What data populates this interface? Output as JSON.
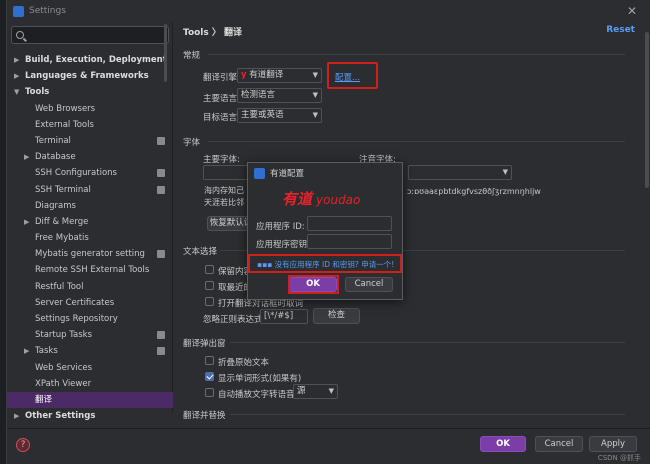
{
  "window": {
    "title": "Settings",
    "close": "✕"
  },
  "search": {
    "placeholder": ""
  },
  "tree": [
    {
      "label": "Build, Execution, Deployment",
      "level": 0,
      "bold": true,
      "chevron": "▶",
      "badge": false
    },
    {
      "label": "Languages & Frameworks",
      "level": 0,
      "bold": true,
      "chevron": "▶",
      "badge": false
    },
    {
      "label": "Tools",
      "level": 0,
      "bold": true,
      "chevron": "▼",
      "badge": false
    },
    {
      "label": "Web Browsers",
      "level": 1,
      "bold": false,
      "chevron": "",
      "badge": false
    },
    {
      "label": "External Tools",
      "level": 1,
      "bold": false,
      "chevron": "",
      "badge": false
    },
    {
      "label": "Terminal",
      "level": 1,
      "bold": false,
      "chevron": "",
      "badge": true
    },
    {
      "label": "Database",
      "level": 1,
      "bold": false,
      "chevron": "▶",
      "badge": false
    },
    {
      "label": "SSH Configurations",
      "level": 1,
      "bold": false,
      "chevron": "",
      "badge": true
    },
    {
      "label": "SSH Terminal",
      "level": 1,
      "bold": false,
      "chevron": "",
      "badge": true
    },
    {
      "label": "Diagrams",
      "level": 1,
      "bold": false,
      "chevron": "",
      "badge": false
    },
    {
      "label": "Diff & Merge",
      "level": 1,
      "bold": false,
      "chevron": "▶",
      "badge": false
    },
    {
      "label": "Free Mybatis",
      "level": 1,
      "bold": false,
      "chevron": "",
      "badge": false
    },
    {
      "label": "Mybatis generator setting",
      "level": 1,
      "bold": false,
      "chevron": "",
      "badge": true
    },
    {
      "label": "Remote SSH External Tools",
      "level": 1,
      "bold": false,
      "chevron": "",
      "badge": false
    },
    {
      "label": "Restful Tool",
      "level": 1,
      "bold": false,
      "chevron": "",
      "badge": false
    },
    {
      "label": "Server Certificates",
      "level": 1,
      "bold": false,
      "chevron": "",
      "badge": false
    },
    {
      "label": "Settings Repository",
      "level": 1,
      "bold": false,
      "chevron": "",
      "badge": false
    },
    {
      "label": "Startup Tasks",
      "level": 1,
      "bold": false,
      "chevron": "",
      "badge": true
    },
    {
      "label": "Tasks",
      "level": 1,
      "bold": false,
      "chevron": "▶",
      "badge": true
    },
    {
      "label": "Web Services",
      "level": 1,
      "bold": false,
      "chevron": "",
      "badge": false
    },
    {
      "label": "XPath Viewer",
      "level": 1,
      "bold": false,
      "chevron": "",
      "badge": false
    },
    {
      "label": "翻译",
      "level": 1,
      "bold": false,
      "chevron": "",
      "badge": false,
      "selected": true
    },
    {
      "label": "Other Settings",
      "level": 0,
      "bold": true,
      "chevron": "▶",
      "badge": false
    }
  ],
  "main": {
    "breadcrumb": "Tools  〉 翻译",
    "reset": "Reset",
    "general": {
      "title": "常规",
      "engine_label": "翻译引擎:",
      "engine_value": "有道翻译",
      "engine_logo": "y",
      "configure_link": "配置...",
      "primary_lang_label": "主要语言:",
      "primary_lang_value": "检测语言",
      "target_lang_label": "目标语言:",
      "target_lang_value": "主要或英语"
    },
    "font": {
      "title": "字体",
      "primary_font_label": "主要字体:",
      "phonetic_font_label": "注音字体:",
      "preview_line1": "海内存知己",
      "preview_line2": "天涯若比邻",
      "preview_phonetic": "ɔːɒʊəaɛpbtdkgfvszθðʃʒrzmnŋhljw",
      "reset_default_btn": "恢复默认设"
    },
    "text_selection": {
      "title": "文本选择",
      "opt1": "保留内容格",
      "opt2": "取最近的一",
      "opt3": "打开翻译对话框时取词",
      "ignore_label": "忽略正则表达式:",
      "ignore_value": "[\\*/#$]",
      "check_btn": "检查"
    },
    "popup": {
      "title": "翻译弹出窗",
      "opt1": "折叠原始文本",
      "opt2": "显示单词形式(如果有)",
      "opt3": "自动播放文字转语音:",
      "opt3_value": "源"
    },
    "replace": {
      "title": "翻译并替换"
    }
  },
  "dialog": {
    "title": "有道配置",
    "logo_cn": "有道",
    "logo_en": "youdao",
    "app_id_label": "应用程序 ID:",
    "app_key_label": "应用程序密钥:",
    "link_prefix": "▪▪▪",
    "link_text": "没有应用程序 ID 和密钥? 申请一个!",
    "ok": "OK",
    "cancel": "Cancel"
  },
  "footer": {
    "help": "?",
    "ok": "OK",
    "cancel": "Cancel",
    "apply": "Apply",
    "watermark": "CSDN @抓手"
  },
  "colors": {
    "accent": "#7b3ea6",
    "link": "#5a9bf5",
    "highlight_box": "#d0201c",
    "youdao_red": "#e8212b"
  }
}
